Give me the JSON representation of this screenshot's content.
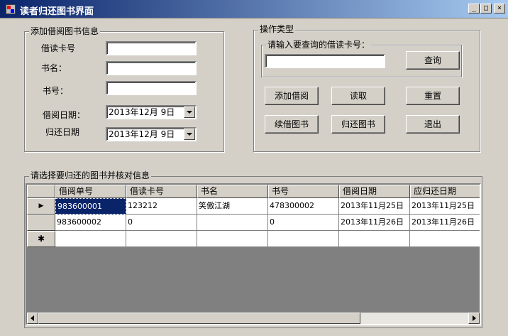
{
  "window": {
    "title": "读者归还图书界面",
    "minimize_glyph": "_",
    "maximize_glyph": "□",
    "close_glyph": "×"
  },
  "borrow_group": {
    "title": "添加借阅图书信息",
    "card_label": "借读卡号",
    "book_name_label": "书名：",
    "book_no_label": "书号：",
    "borrow_date_label": "借阅日期：",
    "return_date_label": "归还日期",
    "card_value": "",
    "book_name_value": "",
    "book_no_value": "",
    "borrow_date_value": "2013年12月  9日",
    "return_date_value": "2013年12月  9日"
  },
  "op_group": {
    "title": "操作类型",
    "query_group_title": "请输入要查询的借读卡号：",
    "query_input_value": "",
    "query_button": "查询",
    "add_button": "添加借阅",
    "read_button": "读取",
    "reset_button": "重置",
    "renew_button": "续借图书",
    "return_button": "归还图书",
    "exit_button": "退出"
  },
  "grid_group": {
    "title": "请选择要归还的图书并核对信息",
    "columns": [
      "借阅单号",
      "借读卡号",
      "书名",
      "书号",
      "借阅日期",
      "应归还日期"
    ],
    "rows": [
      [
        "983600001",
        "123212",
        "笑傲江湖",
        "478300002",
        "2013年11月25日",
        "2013年11月25日"
      ],
      [
        "983600002",
        "0",
        "",
        "0",
        "2013年11月26日",
        "2013年11月26日"
      ]
    ],
    "current_row_marker": "▶",
    "new_row_marker": "✱"
  },
  "icons": {
    "app": "app-icon",
    "scroll_left": "chevron-left-icon",
    "scroll_right": "chevron-right-icon"
  },
  "colors": {
    "title_gradient_start": "#0a246a",
    "title_gradient_end": "#a6caf0",
    "selection": "#0a246a",
    "face": "#d4d0c8"
  }
}
